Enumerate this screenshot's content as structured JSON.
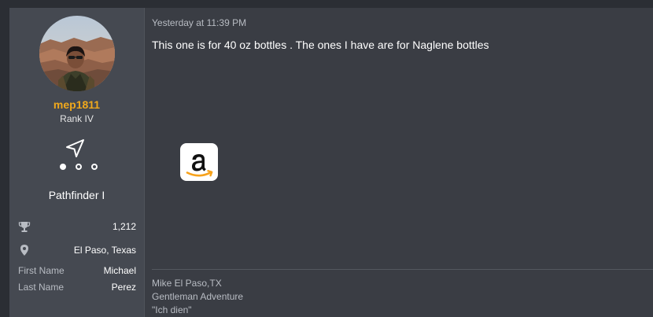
{
  "user": {
    "username": "mep1811",
    "rank": "Rank IV",
    "trophy_title": "Pathfinder I",
    "stats": [
      {
        "icon": "trophy-icon",
        "value": "1,212"
      },
      {
        "icon": "location-pin-icon",
        "value": "El Paso, Texas"
      },
      {
        "label": "First Name",
        "value": "Michael"
      },
      {
        "label": "Last Name",
        "value": "Perez"
      }
    ],
    "progress_dots": {
      "filled": 1,
      "total": 3
    }
  },
  "post": {
    "timestamp": "Yesterday at 11:39 PM",
    "message": "This one is for 40 oz bottles . The ones I have are for Naglene bottles",
    "link_icon": "amazon-icon"
  },
  "signature": {
    "lines": [
      "Mike El Paso,TX",
      "Gentleman Adventure",
      "\"Ich dien\""
    ]
  },
  "colors": {
    "username": "#f0a81c",
    "user_column_bg": "#454951",
    "content_bg": "#3a3d44",
    "page_bg": "#2b2e34"
  }
}
